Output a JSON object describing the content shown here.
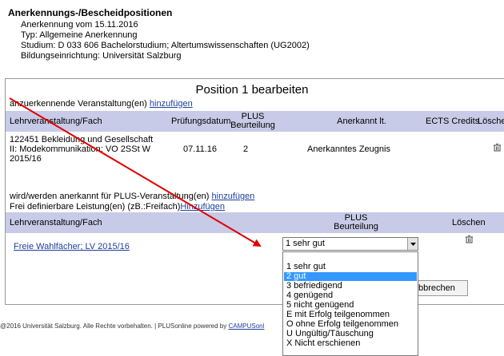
{
  "header": {
    "title": "Anerkennungs-/Bescheidpositionen",
    "lines": [
      "Anerkennung vom 15.11.2016",
      "Typ: Allgemeine Anerkennung",
      "Studium: D 033 606 Bachelorstudium; Altertumswissenschaften (UG2002)",
      "Bildungseinrichtung: Universität Salzburg"
    ]
  },
  "panel": {
    "title": "Position 1 bearbeiten",
    "section1": {
      "label": "anzuerkennende Veranstaltung(en)",
      "add_link": "hinzufügen",
      "columns": [
        "Lehrveranstaltung/Fach",
        "Prüfungsdatum",
        "PLUS",
        "Beurteilung",
        "Anerkannt lt.",
        "ECTS Credits",
        "Lösche"
      ],
      "row": {
        "course_lines": [
          "122451 Bekleidung und Gesellschaft",
          "II: Modekommunikation; VO 2SSt W",
          "2015/16"
        ],
        "date": "07.11.16",
        "grade": "2",
        "recognized_by": "Anerkanntes Zeugnis"
      }
    },
    "section2": {
      "label": "wird/werden anerkannt für PLUS-Veranstaltung(en)",
      "add_link": "hinzufügen",
      "free_label": "Frei definierbare Leistung(en) (zB.:Freifach)",
      "free_link": "Hinzufügen",
      "columns": [
        "Lehrveranstaltung/Fach",
        "PLUS",
        "Beurteilung",
        "Löschen"
      ],
      "row": {
        "course_link": "Freie Wahlfächer; LV 2015/16"
      }
    },
    "select": {
      "value": "1 sehr gut",
      "options": [
        "",
        "1 sehr gut",
        "2 gut",
        "3 befriedigend",
        "4 genügend",
        "5 nicht genügend",
        "E mit Erfolg teilgenommen",
        "O ohne Erfolg teilgenommen",
        "U Ungültig/Täuschung",
        "X Nicht erschienen"
      ],
      "highlighted_index": 2
    },
    "cancel_button": "bbrechen"
  },
  "footer": {
    "text": "@2016 Universität Salzburg. Alle Rechte vorbehalten. | PLUSonline powered by",
    "link": "CAMPUSonl"
  },
  "colors": {
    "table_header": "#c7cbe7",
    "link": "#1f3f99",
    "highlight": "#3399ff",
    "arrow": "#e00000"
  },
  "icons": {
    "delete": "trash-icon",
    "dropdown": "chevron-down-icon"
  }
}
